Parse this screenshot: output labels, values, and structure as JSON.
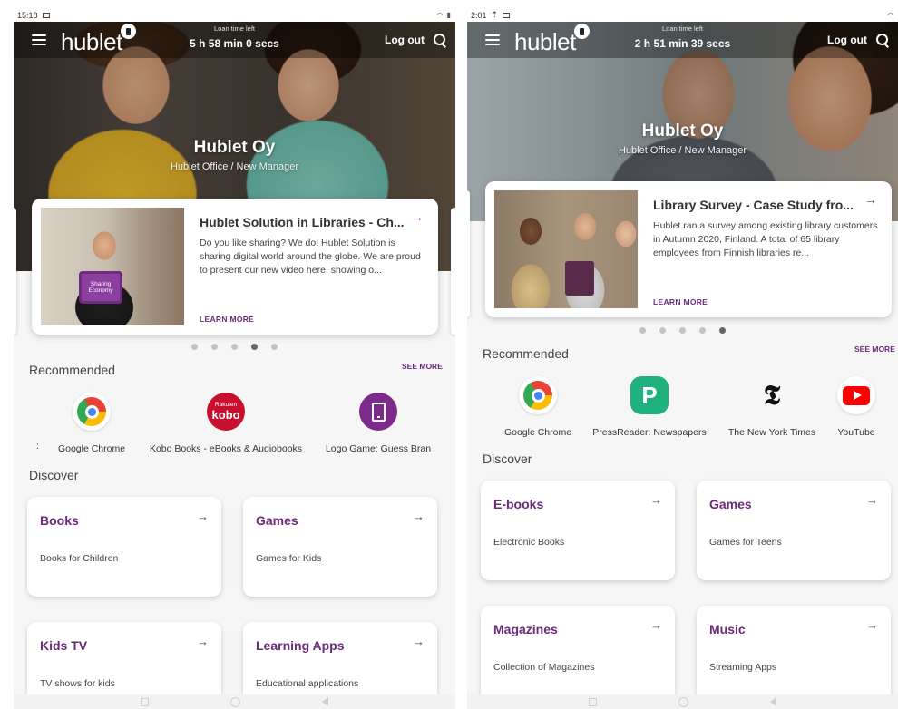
{
  "left": {
    "status": {
      "time": "15:18"
    },
    "header": {
      "logo": "hublet",
      "loan_label": "Loan time left",
      "loan_time": "5 h 58 min 0 secs",
      "logout": "Log out"
    },
    "org": {
      "name": "Hublet Oy",
      "sub": "Hublet Office / New Manager"
    },
    "featured": {
      "title": "Hublet Solution in Libraries - Ch...",
      "desc": "Do you like sharing? We do! Hublet Solution is sharing digital world around the globe. We are proud to present our new video here, showing o...",
      "link": "LEARN MORE",
      "thumb_text": "Sharing Economy",
      "arrow": "→"
    },
    "dots_active": 3,
    "recommended": {
      "title": "Recommended",
      "see_more": "SEE MORE",
      "cut_label": ":",
      "apps": [
        {
          "name": "Google Chrome",
          "icon": "chrome-icon"
        },
        {
          "name": "Kobo Books - eBooks & Audiobooks",
          "icon": "kobo-icon",
          "icon_top": "Rakuten",
          "icon_main": "kobo"
        },
        {
          "name": "Logo Game: Guess Bran",
          "icon": "tablet-icon"
        }
      ]
    },
    "discover": {
      "title": "Discover",
      "cards": [
        {
          "name": "Books",
          "desc": "Books for Children"
        },
        {
          "name": "Games",
          "desc": "Games for Kids"
        },
        {
          "name": "Kids TV",
          "desc": "TV shows for kids"
        },
        {
          "name": "Learning Apps",
          "desc": "Educational applications"
        }
      ]
    }
  },
  "right": {
    "status": {
      "time": "2:01"
    },
    "header": {
      "logo": "hublet",
      "loan_label": "Loan time left",
      "loan_time": "2 h 51 min 39 secs",
      "logout": "Log out"
    },
    "org": {
      "name": "Hublet Oy",
      "sub": "Hublet Office / New Manager"
    },
    "featured": {
      "title": "Library Survey - Case Study fro...",
      "desc": "Hublet ran a survey among existing library customers in Autumn 2020, Finland. A total of 65 library employees from Finnish libraries re...",
      "link": "LEARN MORE",
      "arrow": "→"
    },
    "dots_active": 4,
    "recommended": {
      "title": "Recommended",
      "see_more": "SEE MORE",
      "apps": [
        {
          "name": "Google Chrome",
          "icon": "chrome-icon"
        },
        {
          "name": "PressReader: Newspapers",
          "icon": "pressreader-icon",
          "icon_glyph": "P"
        },
        {
          "name": "The New York Times",
          "icon": "nyt-icon",
          "icon_glyph": "𝕿"
        },
        {
          "name": "YouTube",
          "icon": "youtube-icon"
        }
      ]
    },
    "discover": {
      "title": "Discover",
      "cards": [
        {
          "name": "E-books",
          "desc": "Electronic Books"
        },
        {
          "name": "Games",
          "desc": "Games for Teens"
        },
        {
          "name": "Magazines",
          "desc": "Collection of Magazines"
        },
        {
          "name": "Music",
          "desc": "Streaming Apps"
        }
      ]
    }
  },
  "colors": {
    "accent": "#6b2a7a",
    "pressreader": "#1fb17e",
    "kobo": "#c8102e",
    "youtube": "#ff0000"
  }
}
